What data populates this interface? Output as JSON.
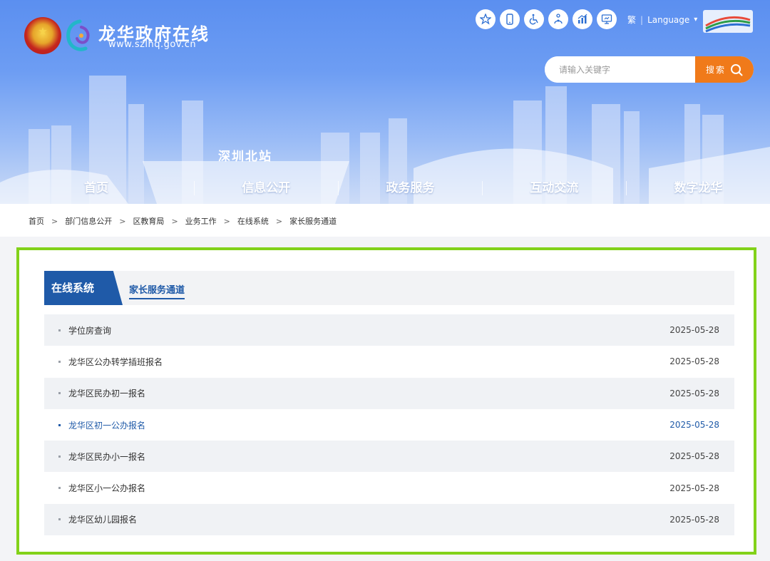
{
  "header": {
    "site_title": "龙华政府在线",
    "site_url": "www.szlhq.gov.cn",
    "station_label": "深圳北站",
    "tool_icons": [
      "accessible-service-icon",
      "mobile-icon",
      "wheelchair-icon",
      "elderly-mode-icon",
      "statistics-icon",
      "screen-display-icon"
    ],
    "traditional_label": "繁",
    "language_label": "Language",
    "search": {
      "placeholder": "请输入关键字",
      "button_label": "搜索"
    }
  },
  "nav": {
    "items": [
      {
        "label": "首页"
      },
      {
        "label": "信息公开"
      },
      {
        "label": "政务服务"
      },
      {
        "label": "互动交流"
      },
      {
        "label": "数字龙华"
      }
    ]
  },
  "breadcrumb": {
    "items": [
      {
        "label": "首页"
      },
      {
        "label": "部门信息公开"
      },
      {
        "label": "区教育局"
      },
      {
        "label": "业务工作"
      },
      {
        "label": "在线系统"
      },
      {
        "label": "家长服务通道"
      }
    ],
    "separator": ">"
  },
  "section": {
    "active_tab": "在线系统",
    "sub_tab": "家长服务通道"
  },
  "list": {
    "items": [
      {
        "title": "学位房查询",
        "date": "2025-05-28"
      },
      {
        "title": "龙华区公办转学插班报名",
        "date": "2025-05-28"
      },
      {
        "title": "龙华区民办初一报名",
        "date": "2025-05-28"
      },
      {
        "title": "龙华区初一公办报名",
        "date": "2025-05-28"
      },
      {
        "title": "龙华区民办小一报名",
        "date": "2025-05-28"
      },
      {
        "title": "龙华区小一公办报名",
        "date": "2025-05-28"
      },
      {
        "title": "龙华区幼儿园报名",
        "date": "2025-05-28"
      }
    ]
  },
  "colors": {
    "brand_blue": "#1f5aa8",
    "search_orange": "#f07a1a",
    "highlight_frame": "#82d21a"
  }
}
